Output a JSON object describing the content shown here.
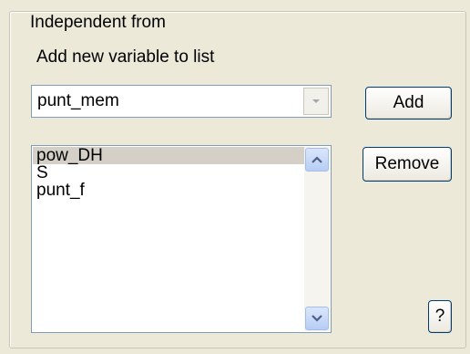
{
  "group": {
    "title": "Independent from",
    "add_label": "Add new variable to list"
  },
  "combo": {
    "selected_value": "punt_mem"
  },
  "buttons": {
    "add": "Add",
    "remove": "Remove",
    "help": "?"
  },
  "list": {
    "items": [
      "pow_DH",
      "S",
      "punt_f"
    ],
    "selected_item": "pow_DH"
  },
  "icons": {
    "combo_arrow": "chevron-down-icon",
    "scroll_up": "scroll-up-arrow-icon",
    "scroll_down": "scroll-down-arrow-icon"
  },
  "colors": {
    "background": "#ece9d8",
    "field_border": "#7f9db9",
    "button_border": "#003c74",
    "selection": "#d4d0c8",
    "scroll_button": "#c1d3fb"
  }
}
